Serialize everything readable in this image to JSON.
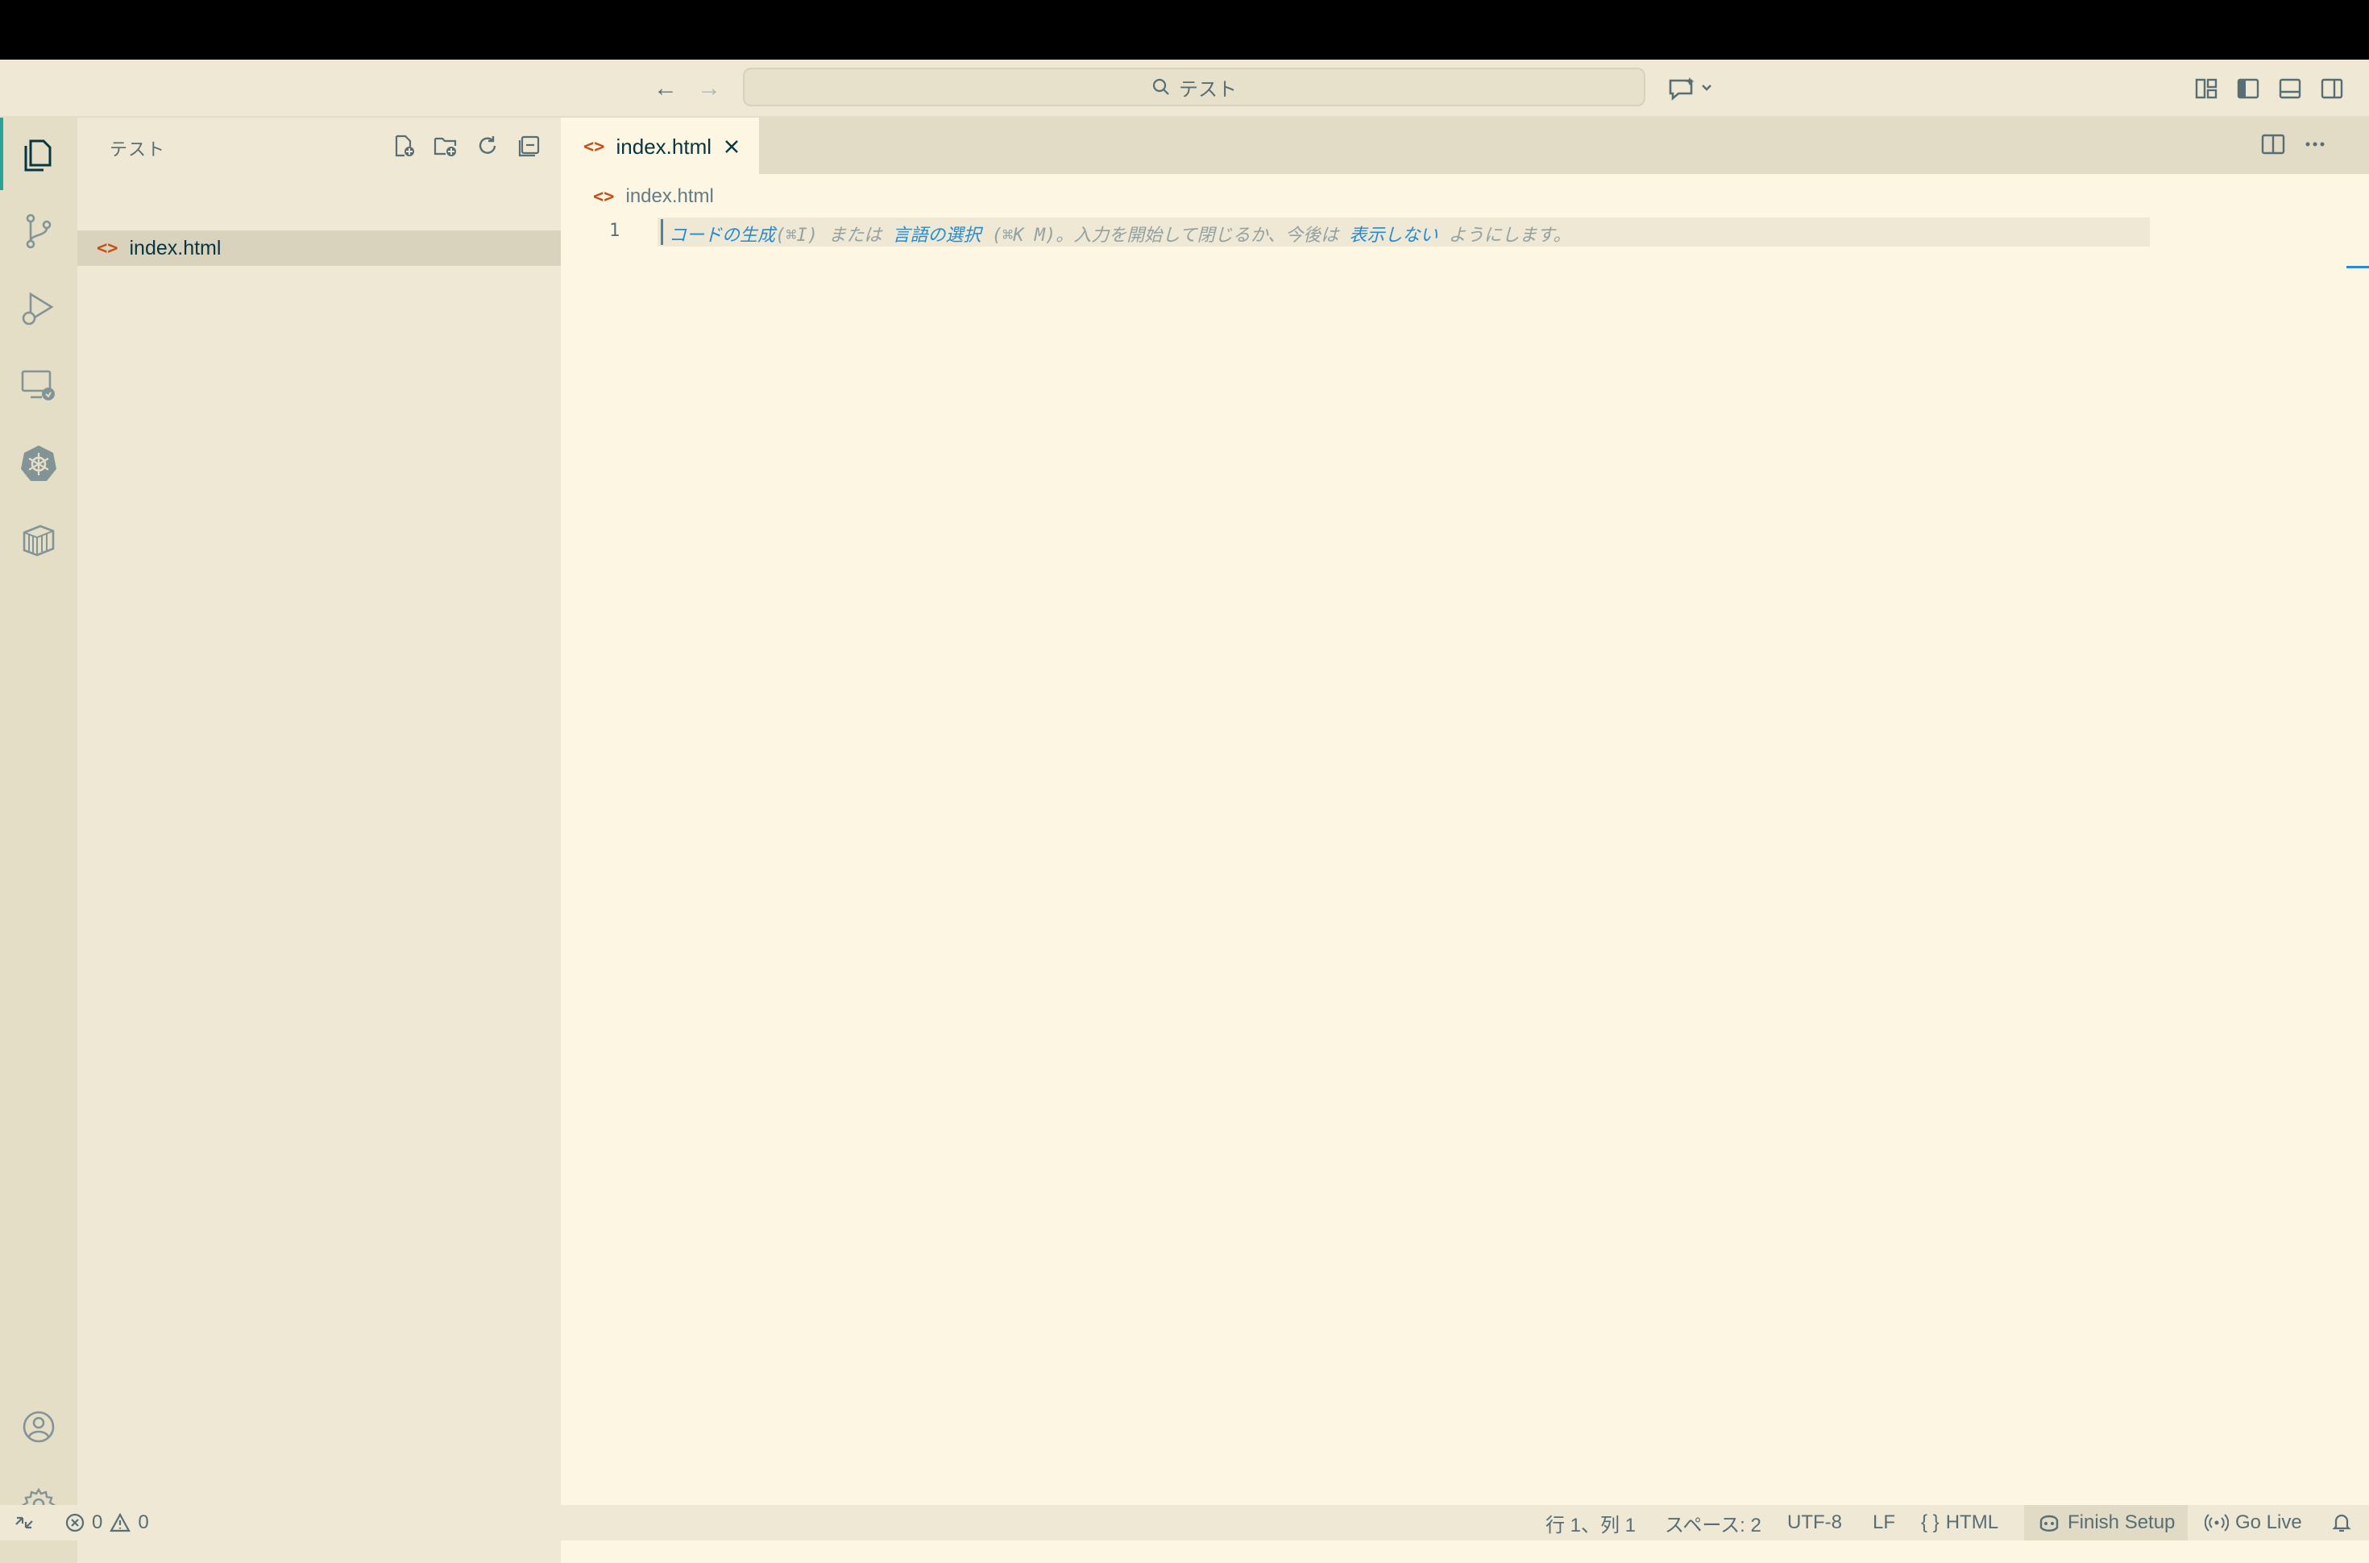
{
  "titlebar": {
    "search_text": "テスト"
  },
  "sidebar": {
    "title": "テスト",
    "files": [
      {
        "name": "index.html"
      }
    ]
  },
  "tabs": [
    {
      "label": "index.html",
      "active": true
    }
  ],
  "editor": {
    "breadcrumb": "index.html",
    "line_number": "1",
    "hint": {
      "part1": "コードの生成",
      "part2": "(⌘I) または ",
      "part3": "言語の選択",
      "part4": " (⌘K M)。入力を開始して閉じるか、今後は ",
      "part5": "表示しない",
      "part6": " ようにします。"
    }
  },
  "statusbar": {
    "errors": "0",
    "warnings": "0",
    "position": "行 1、列 1",
    "spaces": "スペース: 2",
    "encoding": "UTF-8",
    "eol": "LF",
    "braces": "{ }",
    "language": "HTML",
    "finish_setup": "Finish Setup",
    "go_live": "Go Live"
  },
  "colors": {
    "background": "#fdf6e3",
    "sidebar": "#eee8d5",
    "accent": "#268bd2",
    "html_icon": "#cb4b16"
  }
}
